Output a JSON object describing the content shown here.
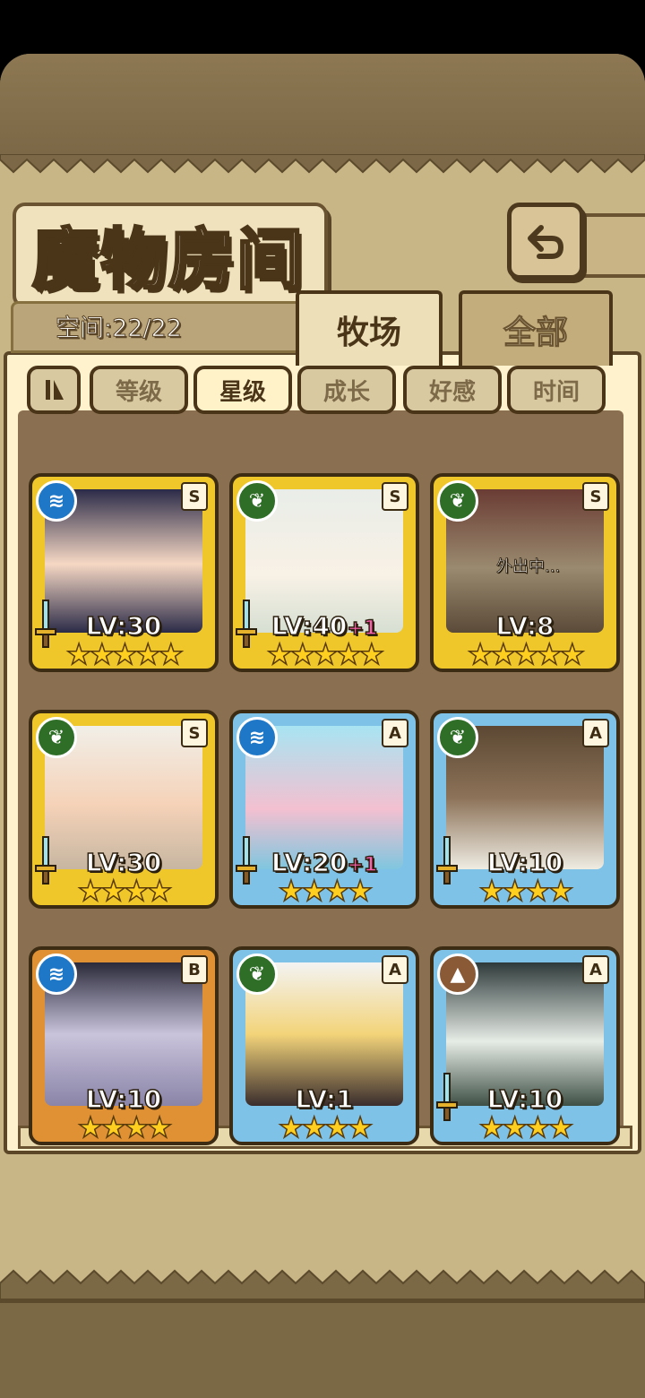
{
  "title": "魔物房间",
  "capacity": "空间:22/22",
  "tabs": [
    {
      "label": "牧场",
      "active": true
    },
    {
      "label": "全部",
      "active": false
    }
  ],
  "sort_buttons": [
    {
      "label": "等级",
      "active": false
    },
    {
      "label": "星级",
      "active": true
    },
    {
      "label": "成长",
      "active": false
    },
    {
      "label": "好感",
      "active": false
    },
    {
      "label": "时间",
      "active": false
    }
  ],
  "cards": [
    {
      "element": "water",
      "rank": "S",
      "frame": "gold",
      "level": "LV:30",
      "plus": "",
      "stars": "★★★★★",
      "has_weapon": true,
      "away": ""
    },
    {
      "element": "nature",
      "rank": "S",
      "frame": "gold",
      "level": "LV:40",
      "plus": "+1",
      "stars": "★★★★★",
      "has_weapon": true,
      "away": ""
    },
    {
      "element": "nature",
      "rank": "S",
      "frame": "gold",
      "level": "LV:8",
      "plus": "",
      "stars": "★★★★★",
      "has_weapon": false,
      "away": "外出中..."
    },
    {
      "element": "nature",
      "rank": "S",
      "frame": "gold",
      "level": "LV:30",
      "plus": "",
      "stars": "★★★★",
      "has_weapon": true,
      "away": ""
    },
    {
      "element": "water",
      "rank": "A",
      "frame": "blue",
      "level": "LV:20",
      "plus": "+1",
      "stars": "★★★★",
      "has_weapon": true,
      "away": ""
    },
    {
      "element": "nature",
      "rank": "A",
      "frame": "blue",
      "level": "LV:10",
      "plus": "",
      "stars": "★★★★",
      "has_weapon": true,
      "away": ""
    },
    {
      "element": "water",
      "rank": "B",
      "frame": "bronze",
      "level": "LV:10",
      "plus": "",
      "stars": "★★★★",
      "has_weapon": false,
      "away": ""
    },
    {
      "element": "nature",
      "rank": "A",
      "frame": "blue",
      "level": "LV:1",
      "plus": "",
      "stars": "★★★★",
      "has_weapon": false,
      "away": ""
    },
    {
      "element": "earth",
      "rank": "A",
      "frame": "blue",
      "level": "LV:10",
      "plus": "",
      "stars": "★★★★",
      "has_weapon": true,
      "away": ""
    }
  ]
}
